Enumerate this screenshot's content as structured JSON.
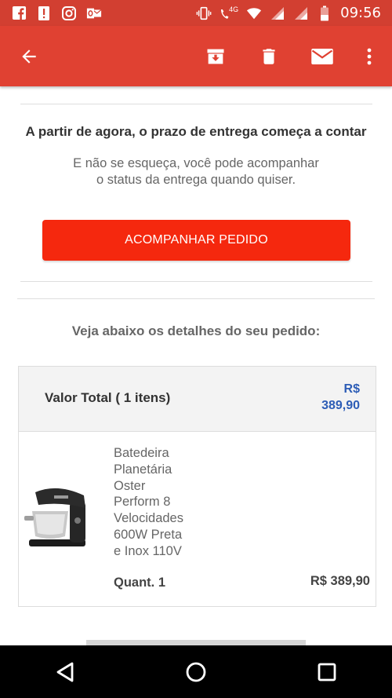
{
  "status_bar": {
    "time": "09:56",
    "left_icons": [
      "facebook-icon",
      "alert-icon",
      "instagram-icon",
      "outlook-icon"
    ],
    "right_icons": [
      "vibrate-icon",
      "wifi-calling-4g-icon",
      "wifi-icon",
      "signal-icon",
      "signal-icon",
      "battery-icon"
    ],
    "network_label": "4G"
  },
  "app_bar": {
    "background": "#e04132",
    "actions": [
      "archive-icon",
      "delete-icon",
      "mail-icon",
      "more-vert-icon"
    ]
  },
  "message": {
    "headline": "A partir de agora, o prazo de entrega começa a contar",
    "subline_1": "E não se esqueça, você pode acompanhar",
    "subline_2": "o status da entrega quando quiser.",
    "button_label": "ACOMPANHAR PEDIDO",
    "button_color": "#f5280e"
  },
  "order": {
    "section_title": "Veja abaixo os detalhes do seu pedido:",
    "total_label": "Valor Total ( 1 itens)",
    "total_currency": "R$",
    "total_value": "389,90",
    "accent": "#2d5db6",
    "item": {
      "name_lines": [
        "Batedeira",
        "Planetária",
        "Oster",
        "Perform 8",
        "Velocidades",
        "600W Preta",
        "e Inox 110V"
      ],
      "quantity": "Quant. 1",
      "price": "R$ 389,90"
    }
  },
  "nav_bar": [
    "back-triangle-icon",
    "home-circle-icon",
    "recents-square-icon"
  ]
}
